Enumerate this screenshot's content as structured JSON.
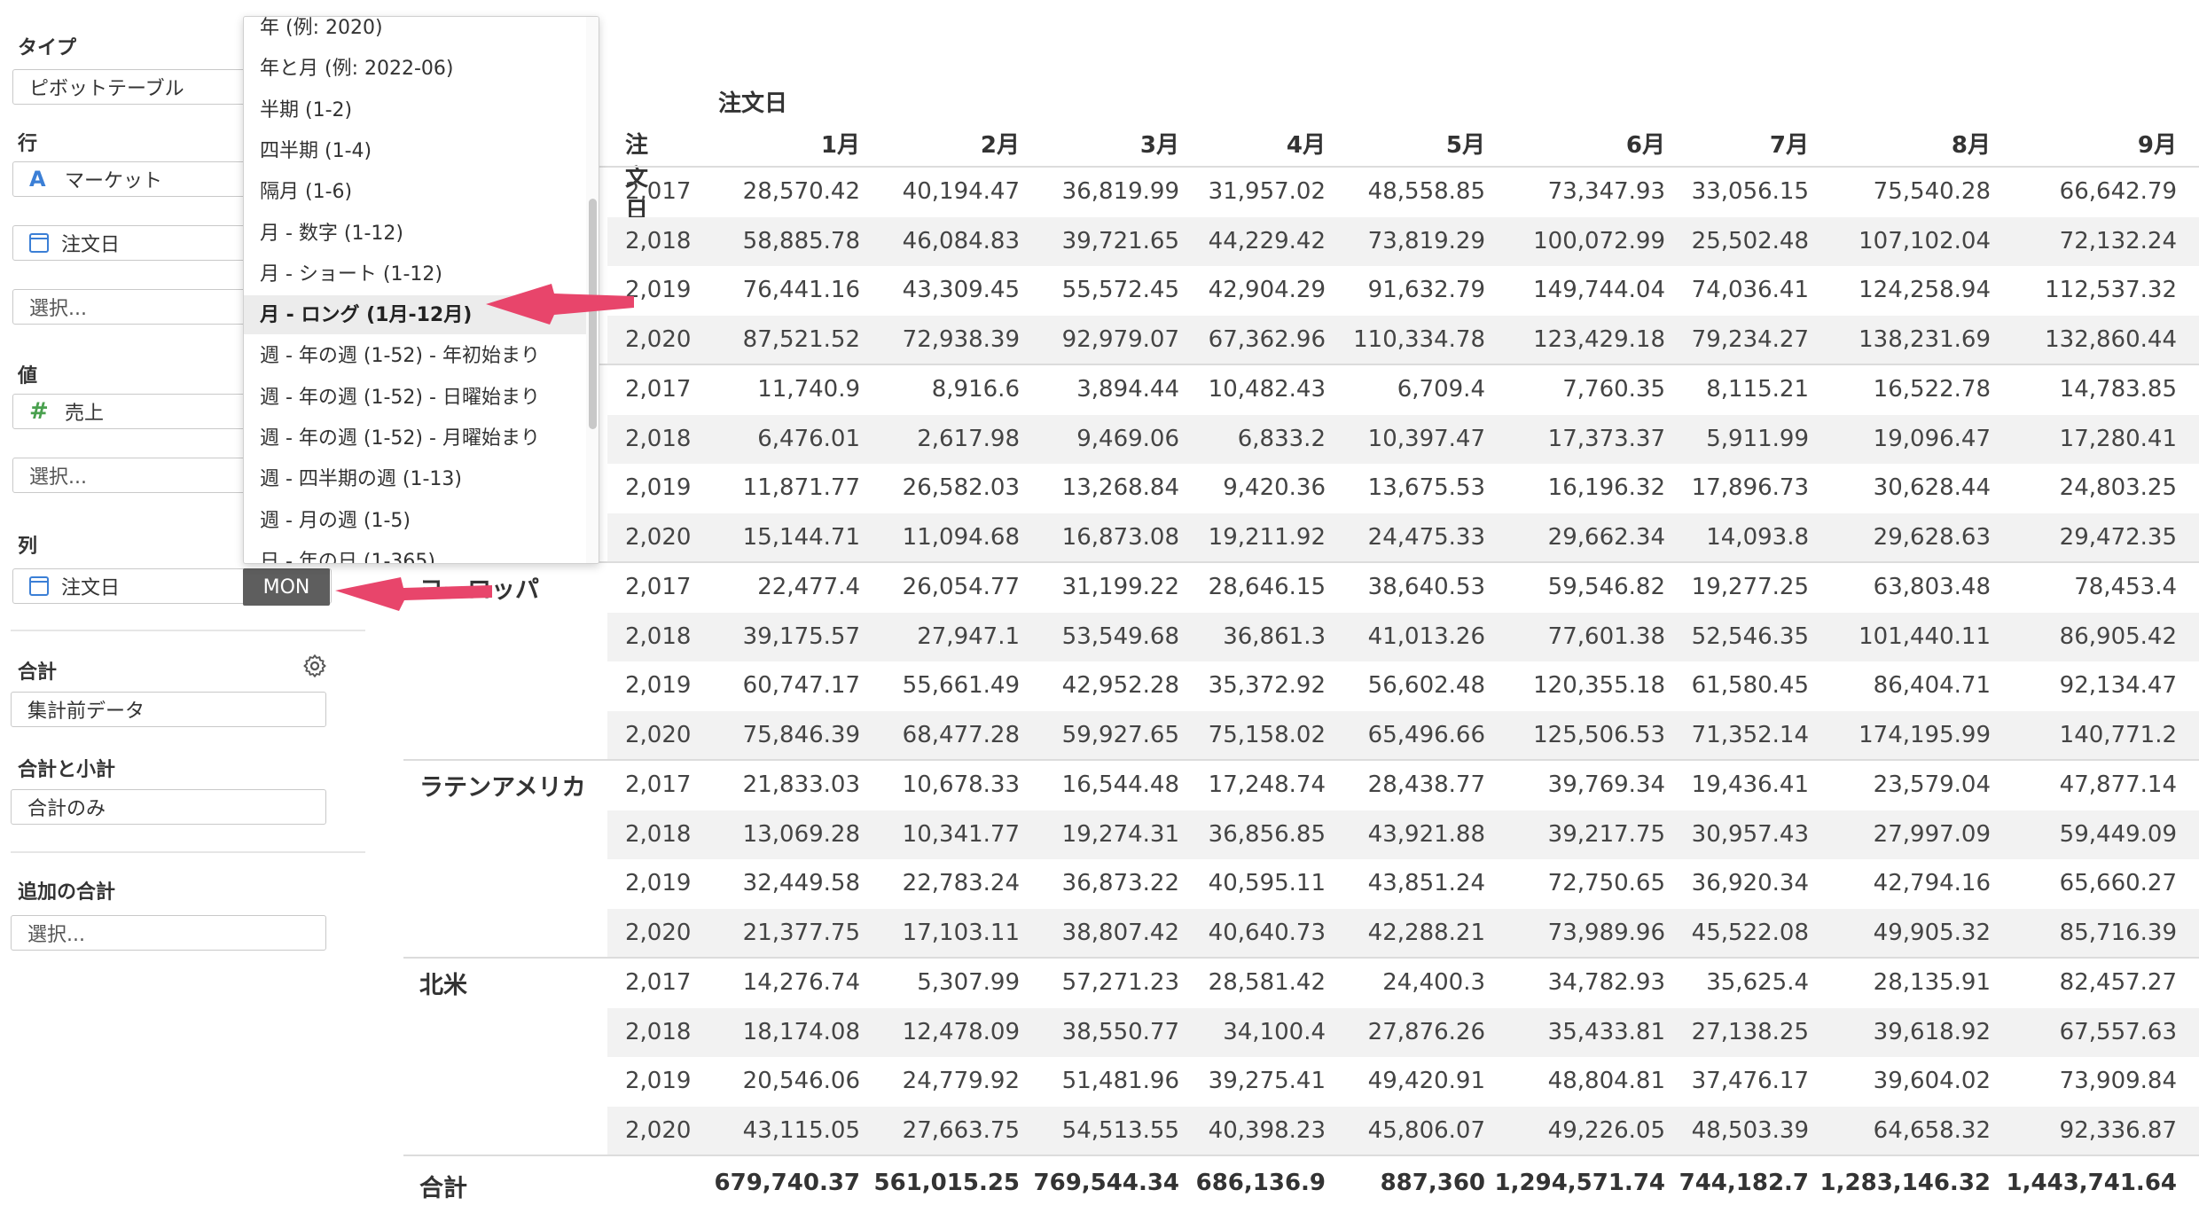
{
  "sidebar": {
    "type_label": "タイプ",
    "type_value": "ピボットテーブル",
    "row_label": "行",
    "row_fields": [
      {
        "icon": "text-type-icon",
        "icon_glyph": "A",
        "name": "マーケット"
      },
      {
        "icon": "calendar-icon",
        "name": "注文日"
      }
    ],
    "row_select_placeholder": "選択...",
    "value_label": "値",
    "value_field": {
      "icon": "number-type-icon",
      "icon_glyph": "#",
      "name": "売上"
    },
    "value_select_placeholder": "選択...",
    "column_label": "列",
    "column_field": {
      "icon": "calendar-icon",
      "name": "注文日",
      "badge": "MON"
    },
    "aggregate_label": "合計",
    "aggregate_value": "集計前データ",
    "subtotal_label": "合計と小計",
    "subtotal_value": "合計のみ",
    "extra_total_label": "追加の合計",
    "extra_total_placeholder": "選択..."
  },
  "dropdown": {
    "items": [
      "年 (例: 2020)",
      "年と月 (例: 2022-06)",
      "半期 (1-2)",
      "四半期 (1-4)",
      "隔月 (1-6)",
      "月 - 数字 (1-12)",
      "月 - ショート (1-12)",
      "月 - ロング (1月-12月)",
      "週 - 年の週 (1-52) - 年初始まり",
      "週 - 年の週 (1-52) - 日曜始まり",
      "週 - 年の週 (1-52) - 月曜始まり",
      "週 - 四半期の週 (1-13)",
      "週 - 月の週 (1-5)",
      "日 - 年の日 (1-365)"
    ],
    "selected_index": 7
  },
  "table": {
    "column_group_label": "注文日",
    "row_header": "注文日",
    "months": [
      "1月",
      "2月",
      "3月",
      "4月",
      "5月",
      "6月",
      "7月",
      "8月",
      "9月"
    ],
    "groups": [
      {
        "market": "",
        "rows": [
          {
            "year": "2,017",
            "values": [
              "28,570.42",
              "40,194.47",
              "36,819.99",
              "31,957.02",
              "48,558.85",
              "73,347.93",
              "33,056.15",
              "75,540.28",
              "66,642.79"
            ]
          },
          {
            "year": "2,018",
            "values": [
              "58,885.78",
              "46,084.83",
              "39,721.65",
              "44,229.42",
              "73,819.29",
              "100,072.99",
              "25,502.48",
              "107,102.04",
              "72,132.24"
            ]
          },
          {
            "year": "2,019",
            "values": [
              "76,441.16",
              "43,309.45",
              "55,572.45",
              "42,904.29",
              "91,632.79",
              "149,744.04",
              "74,036.41",
              "124,258.94",
              "112,537.32"
            ]
          },
          {
            "year": "2,020",
            "values": [
              "87,521.52",
              "72,938.39",
              "92,979.07",
              "67,362.96",
              "110,334.78",
              "123,429.18",
              "79,234.27",
              "138,231.69",
              "132,860.44"
            ]
          }
        ]
      },
      {
        "market": "",
        "rows": [
          {
            "year": "2,017",
            "values": [
              "11,740.9",
              "8,916.6",
              "3,894.44",
              "10,482.43",
              "6,709.4",
              "7,760.35",
              "8,115.21",
              "16,522.78",
              "14,783.85"
            ]
          },
          {
            "year": "2,018",
            "values": [
              "6,476.01",
              "2,617.98",
              "9,469.06",
              "6,833.2",
              "10,397.47",
              "17,373.37",
              "5,911.99",
              "19,096.47",
              "17,280.41"
            ]
          },
          {
            "year": "2,019",
            "values": [
              "11,871.77",
              "26,582.03",
              "13,268.84",
              "9,420.36",
              "13,675.53",
              "16,196.32",
              "17,896.73",
              "30,628.44",
              "24,803.25"
            ]
          },
          {
            "year": "2,020",
            "values": [
              "15,144.71",
              "11,094.68",
              "16,873.08",
              "19,211.92",
              "24,475.33",
              "29,662.34",
              "14,093.8",
              "29,628.63",
              "29,472.35"
            ]
          }
        ]
      },
      {
        "market": "ヨーロッパ",
        "rows": [
          {
            "year": "2,017",
            "values": [
              "22,477.4",
              "26,054.77",
              "31,199.22",
              "28,646.15",
              "38,640.53",
              "59,546.82",
              "19,277.25",
              "63,803.48",
              "78,453.4"
            ]
          },
          {
            "year": "2,018",
            "values": [
              "39,175.57",
              "27,947.1",
              "53,549.68",
              "36,861.3",
              "41,013.26",
              "77,601.38",
              "52,546.35",
              "101,440.11",
              "86,905.42"
            ]
          },
          {
            "year": "2,019",
            "values": [
              "60,747.17",
              "55,661.49",
              "42,952.28",
              "35,372.92",
              "56,602.48",
              "120,355.18",
              "61,580.45",
              "86,404.71",
              "92,134.47"
            ]
          },
          {
            "year": "2,020",
            "values": [
              "75,846.39",
              "68,477.28",
              "59,927.65",
              "75,158.02",
              "65,496.66",
              "125,506.53",
              "71,352.14",
              "174,195.99",
              "140,771.2"
            ]
          }
        ]
      },
      {
        "market": "ラテンアメリカ",
        "rows": [
          {
            "year": "2,017",
            "values": [
              "21,833.03",
              "10,678.33",
              "16,544.48",
              "17,248.74",
              "28,438.77",
              "39,769.34",
              "19,436.41",
              "23,579.04",
              "47,877.14"
            ]
          },
          {
            "year": "2,018",
            "values": [
              "13,069.28",
              "10,341.77",
              "19,274.31",
              "36,856.85",
              "43,921.88",
              "39,217.75",
              "30,957.43",
              "27,997.09",
              "59,449.09"
            ]
          },
          {
            "year": "2,019",
            "values": [
              "32,449.58",
              "22,783.24",
              "36,873.22",
              "40,595.11",
              "43,851.24",
              "72,750.65",
              "36,920.34",
              "42,794.16",
              "65,660.27"
            ]
          },
          {
            "year": "2,020",
            "values": [
              "21,377.75",
              "17,103.11",
              "38,807.42",
              "40,640.73",
              "42,288.21",
              "73,989.96",
              "45,522.08",
              "49,905.32",
              "85,716.39"
            ]
          }
        ]
      },
      {
        "market": "北米",
        "rows": [
          {
            "year": "2,017",
            "values": [
              "14,276.74",
              "5,307.99",
              "57,271.23",
              "28,581.42",
              "24,400.3",
              "34,782.93",
              "35,625.4",
              "28,135.91",
              "82,457.27"
            ]
          },
          {
            "year": "2,018",
            "values": [
              "18,174.08",
              "12,478.09",
              "38,550.77",
              "34,100.4",
              "27,876.26",
              "35,433.81",
              "27,138.25",
              "39,618.92",
              "67,557.63"
            ]
          },
          {
            "year": "2,019",
            "values": [
              "20,546.06",
              "24,779.92",
              "51,481.96",
              "39,275.41",
              "49,420.91",
              "48,804.81",
              "37,476.17",
              "39,604.02",
              "73,909.84"
            ]
          },
          {
            "year": "2,020",
            "values": [
              "43,115.05",
              "27,663.75",
              "54,513.55",
              "40,398.23",
              "45,806.07",
              "49,226.05",
              "48,503.39",
              "64,658.32",
              "92,336.87"
            ]
          }
        ]
      }
    ],
    "total_label": "合計",
    "totals": [
      "679,740.37",
      "561,015.25",
      "769,544.34",
      "686,136.9",
      "887,360",
      "1,294,571.74",
      "744,182.7",
      "1,283,146.32",
      "1,443,741.64"
    ]
  },
  "annotation_color": "#e8456b"
}
